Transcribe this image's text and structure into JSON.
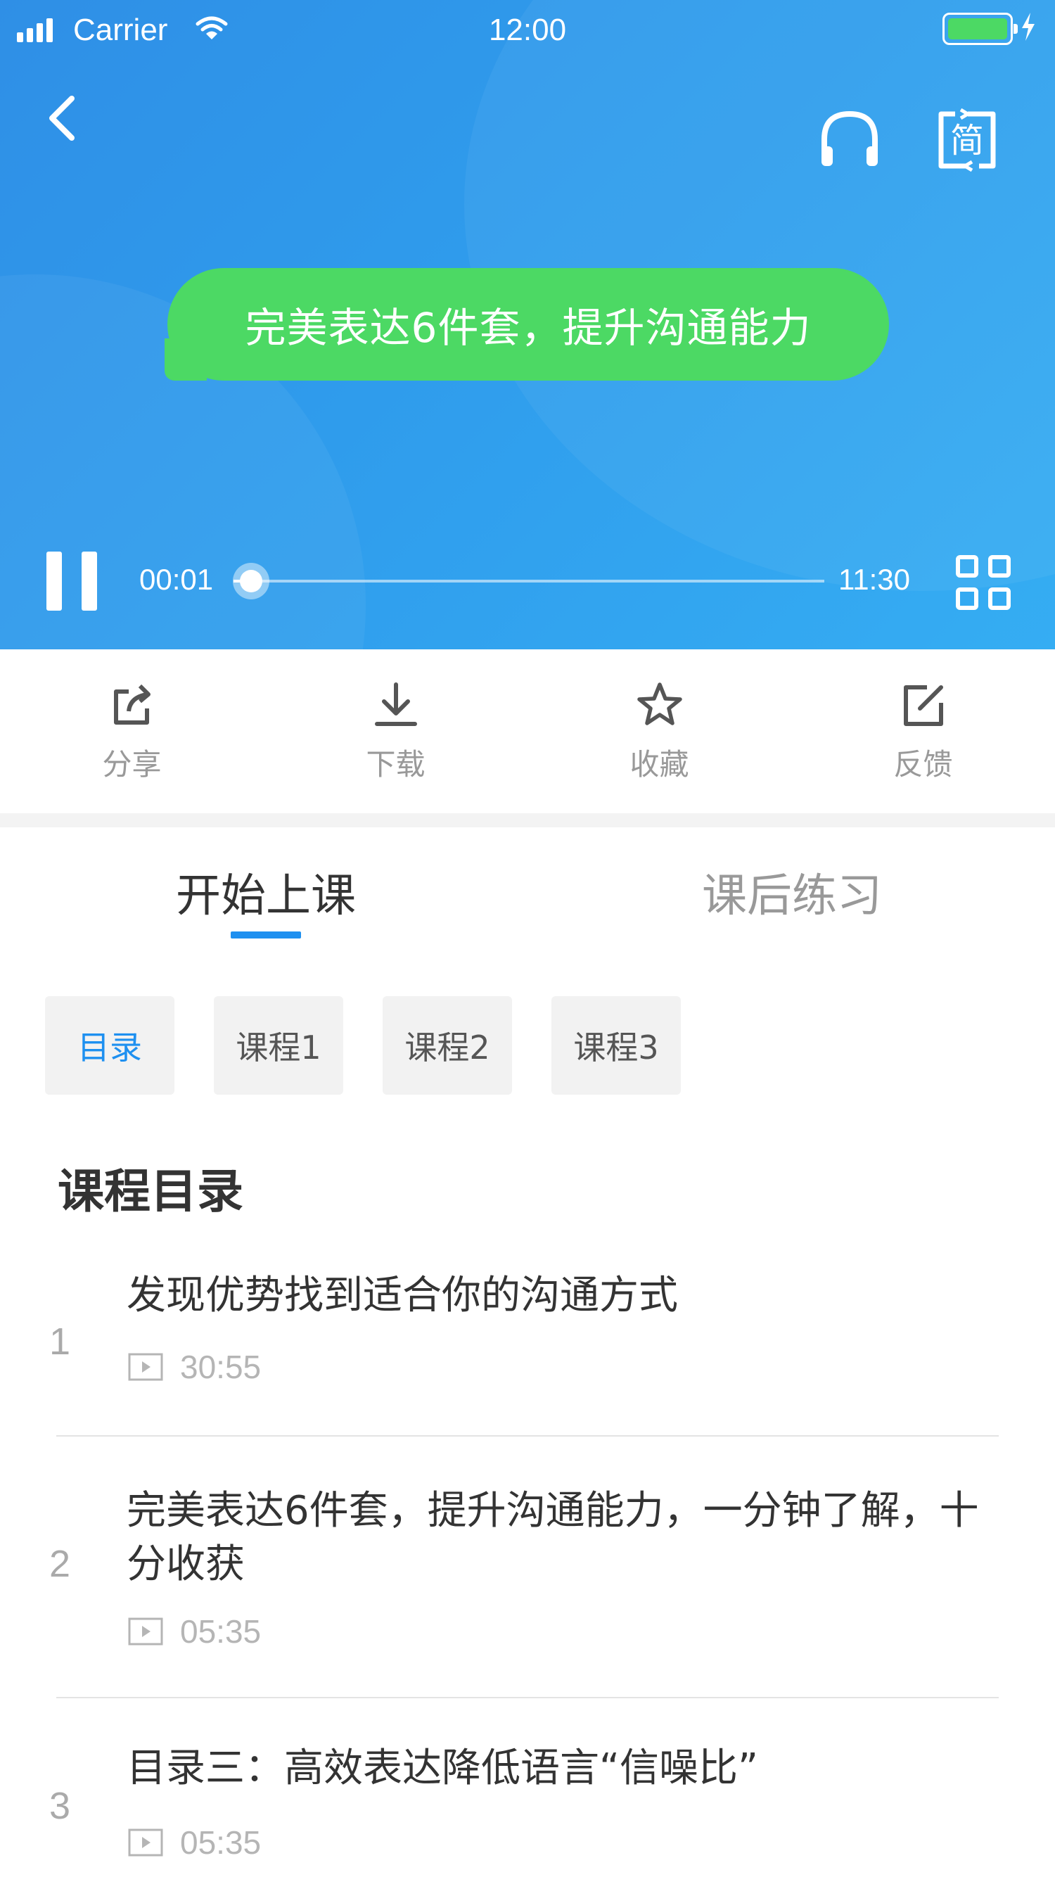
{
  "status_bar": {
    "carrier": "Carrier",
    "time": "12:00",
    "battery_color": "#4cd964"
  },
  "header": {
    "back_icon": "chevron-left-icon",
    "headphone_icon": "headphone-icon",
    "simplified_icon": "simplified-chinese-icon",
    "simplified_label": "简"
  },
  "player": {
    "title": "完美表达6件套，提升沟通能力",
    "current_time": "00:01",
    "total_time": "11:30",
    "progress": 0.03,
    "pause_icon": "pause-icon",
    "grid_icon": "grid-icon",
    "accent_bubble_color": "#4cd964"
  },
  "actions": [
    {
      "label": "分享",
      "icon": "share-icon"
    },
    {
      "label": "下载",
      "icon": "download-icon"
    },
    {
      "label": "收藏",
      "icon": "star-icon"
    },
    {
      "label": "反馈",
      "icon": "feedback-icon"
    }
  ],
  "tabs": [
    {
      "label": "开始上课",
      "active": true
    },
    {
      "label": "课后练习",
      "active": false
    }
  ],
  "chips": [
    {
      "label": "目录",
      "active": true
    },
    {
      "label": "课程1",
      "active": false
    },
    {
      "label": "课程2",
      "active": false
    },
    {
      "label": "课程3",
      "active": false
    }
  ],
  "catalog": {
    "title": "课程目录",
    "lessons": [
      {
        "index": "1",
        "title": "发现优势找到适合你的沟通方式",
        "duration": "30:55"
      },
      {
        "index": "2",
        "title": "完美表达6件套，提升沟通能力，一分钟了解，十分收获",
        "duration": "05:35"
      },
      {
        "index": "3",
        "title": "目录三：高效表达降低语言“信噪比”",
        "duration": "05:35"
      }
    ]
  },
  "colors": {
    "accent": "#1e90f0",
    "header_gradient_start": "#2f8fe6",
    "header_gradient_end": "#35adf3"
  }
}
